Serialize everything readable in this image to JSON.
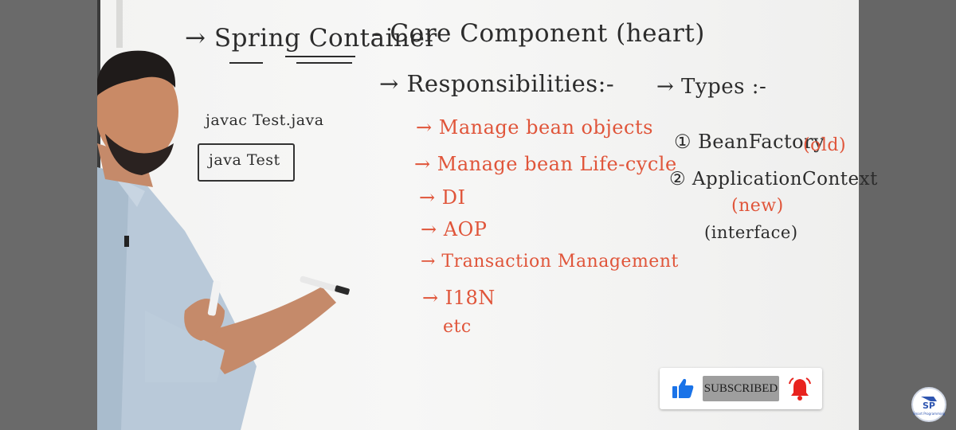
{
  "board": {
    "title_prefix": "→ Spring Container",
    "title_suffix": "- Core Component (heart)",
    "responsibilities_header": "→ Responsibilities:-",
    "responsibilities": [
      "→ Manage bean objects",
      "→ Manage bean Life-cycle",
      "→ DI",
      "→ AOP",
      "→ Transaction Management",
      "→ I18N",
      "etc"
    ],
    "types_header": "→ Types :-",
    "types": [
      "① BeanFactory",
      "② ApplicationContext"
    ],
    "type_notes": {
      "old": "(old)",
      "new": "(new)",
      "interface": "(interface)"
    },
    "side_notes": {
      "compile": "javac Test.java",
      "run": "java Test"
    }
  },
  "overlay": {
    "subscribe_label": "SUBSCRIBED",
    "like_icon": "thumbs-up-icon",
    "bell_icon": "bell-icon",
    "accent_blue": "#1a73e8",
    "accent_red": "#e8231e"
  },
  "channel": {
    "logo_text": "SP",
    "logo_subtext": "Smart Programming"
  }
}
